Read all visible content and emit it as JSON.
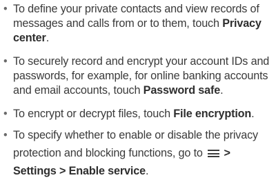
{
  "bullets": [
    {
      "marker": "•",
      "text_before": "To define your private contacts and view records of messages and calls from or to them, touch ",
      "bold": "Privacy center",
      "text_after": "."
    },
    {
      "marker": "•",
      "text_before": "To securely record and encrypt your account IDs and passwords, for example, for online banking accounts and email accounts, touch ",
      "bold": "Password safe",
      "text_after": "."
    },
    {
      "marker": "•",
      "text_before": "To encrypt or decrypt files, touch ",
      "bold": "File encryption",
      "text_after": "."
    },
    {
      "marker": "•",
      "text_before": "To specify whether to enable or disable the privacy protection and blocking functions, go to ",
      "icon": "menu-icon",
      "bold": "> Settings > Enable service",
      "text_after": "."
    }
  ]
}
